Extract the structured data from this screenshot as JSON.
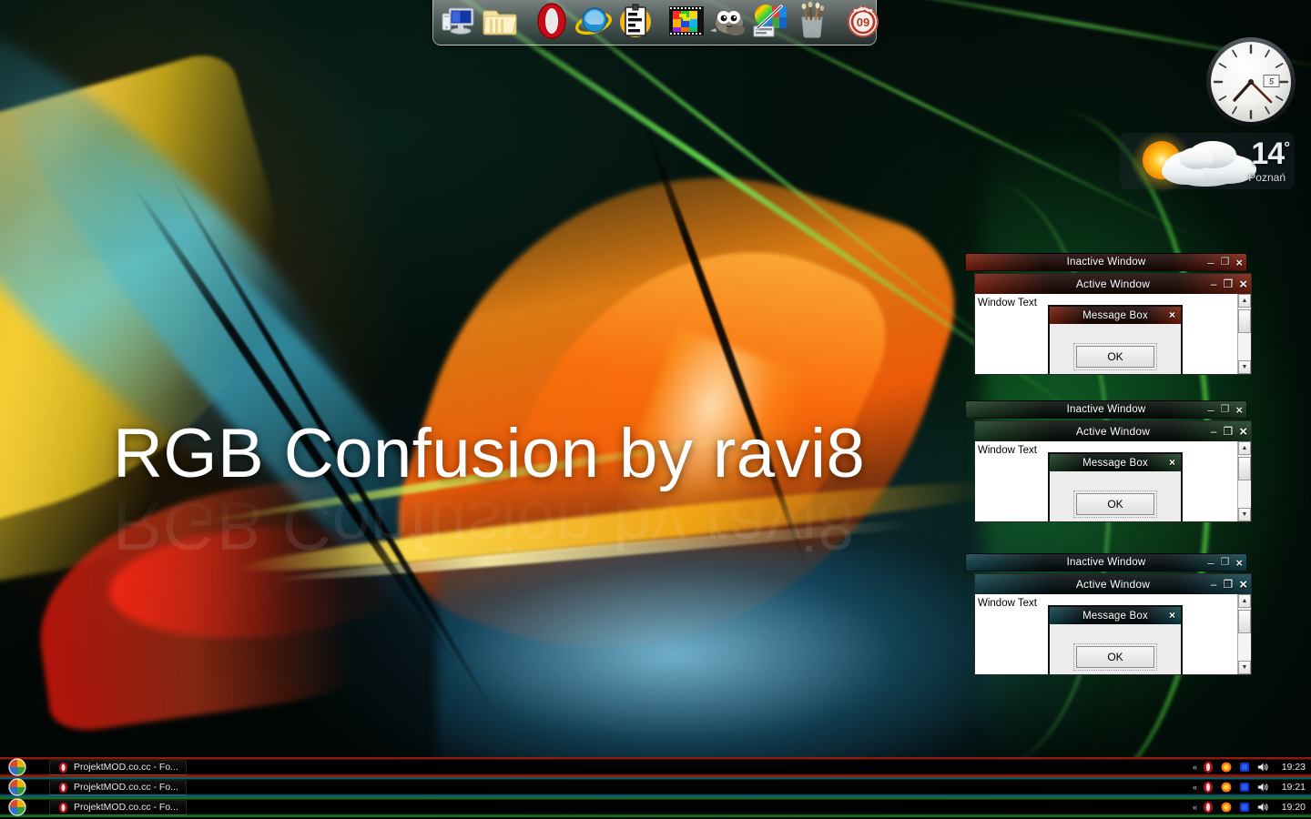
{
  "desktop": {
    "wallpaper_title": "RGB Confusion by ravi8",
    "wallpaper_title_reflection": "RGB Confusion by ravi8"
  },
  "dock": {
    "groups": [
      {
        "items": [
          {
            "name": "computer-icon",
            "label": "Computer"
          },
          {
            "name": "folder-icon",
            "label": "Documents"
          }
        ]
      },
      {
        "items": [
          {
            "name": "opera-icon",
            "label": "Opera"
          },
          {
            "name": "internet-explorer-icon",
            "label": "Internet Explorer"
          },
          {
            "name": "notes-icon",
            "label": "Notes"
          }
        ]
      },
      {
        "items": [
          {
            "name": "color-grid-icon",
            "label": "Color Grid"
          },
          {
            "name": "gimp-icon",
            "label": "GIMP"
          },
          {
            "name": "photo-editor-icon",
            "label": "Photo Editor"
          },
          {
            "name": "paint-tools-icon",
            "label": "Paint Tools"
          }
        ]
      },
      {
        "items": [
          {
            "name": "badge-09-icon",
            "label": "09"
          }
        ]
      }
    ]
  },
  "gadgets": {
    "clock": {
      "name": "analog-clock-gadget",
      "date": "5"
    },
    "weather": {
      "name": "weather-gadget",
      "temperature": "14",
      "degree": "°",
      "city": "Poznań"
    }
  },
  "window_groups": [
    {
      "accent": "#7d1e0a",
      "accent_dark": "#1a0603",
      "inactive": {
        "title": "Inactive Window",
        "minimize": "–",
        "maximize": "❐",
        "close": "×"
      },
      "active": {
        "title": "Active Window",
        "minimize": "–",
        "maximize": "❐",
        "close": "×",
        "body_text": "Window Text"
      },
      "messagebox": {
        "title": "Message Box",
        "close": "×",
        "ok_label": "OK"
      },
      "scrollbar": {
        "up": "▲",
        "down": "▼"
      }
    },
    {
      "accent": "#1b4023",
      "accent_dark": "#040c06",
      "inactive": {
        "title": "Inactive Window",
        "minimize": "–",
        "maximize": "❐",
        "close": "×"
      },
      "active": {
        "title": "Active Window",
        "minimize": "–",
        "maximize": "❐",
        "close": "×",
        "body_text": "Window Text"
      },
      "messagebox": {
        "title": "Message Box",
        "close": "×",
        "ok_label": "OK"
      },
      "scrollbar": {
        "up": "▲",
        "down": "▼"
      }
    },
    {
      "accent": "#0f4550",
      "accent_dark": "#020c0f",
      "inactive": {
        "title": "Inactive Window",
        "minimize": "–",
        "maximize": "❐",
        "close": "×"
      },
      "active": {
        "title": "Active Window",
        "minimize": "–",
        "maximize": "❐",
        "close": "×",
        "body_text": "Window Text"
      },
      "messagebox": {
        "title": "Message Box",
        "close": "×",
        "ok_label": "OK"
      },
      "scrollbar": {
        "up": "▲",
        "down": "▼"
      }
    }
  ],
  "taskbars": [
    {
      "accent": "#8c1d0c",
      "start_label": "Start",
      "task": {
        "label": "ProjektMOD.co.cc - Fo...",
        "icon": "opera-icon"
      },
      "tray": {
        "chevron": "«",
        "icons": [
          "opera-tray-icon",
          "sun-tray-icon",
          "blue-tray-icon",
          "speaker-tray-icon"
        ],
        "clock": "19:23"
      }
    },
    {
      "accent": "#0e5a68",
      "start_label": "Start",
      "task": {
        "label": "ProjektMOD.co.cc - Fo...",
        "icon": "opera-icon"
      },
      "tray": {
        "chevron": "«",
        "icons": [
          "opera-tray-icon",
          "sun-tray-icon",
          "blue-tray-icon",
          "speaker-tray-icon"
        ],
        "clock": "19:21"
      }
    },
    {
      "accent": "#1d6b22",
      "start_label": "Start",
      "task": {
        "label": "ProjektMOD.co.cc - Fo...",
        "icon": "opera-icon"
      },
      "tray": {
        "chevron": "«",
        "icons": [
          "opera-tray-icon",
          "sun-tray-icon",
          "blue-tray-icon",
          "speaker-tray-icon"
        ],
        "clock": "19:20"
      }
    }
  ]
}
